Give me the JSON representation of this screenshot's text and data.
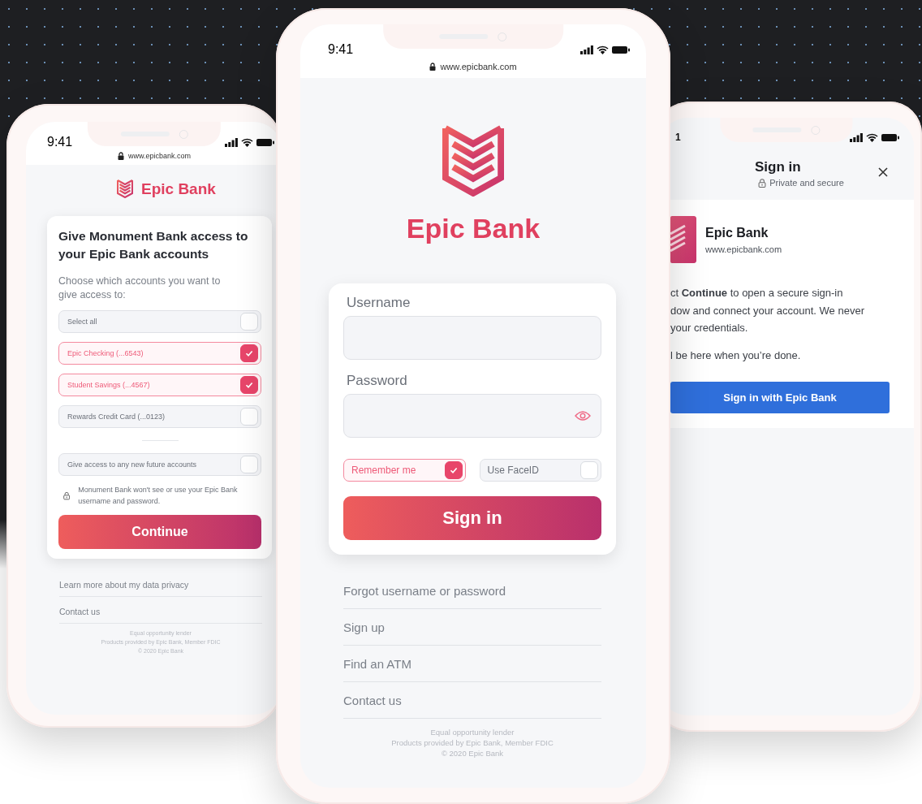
{
  "left_phone": {
    "status_time": "9:41",
    "url": "www.epicbank.com",
    "brand": "Epic Bank",
    "title": "Give Monument Bank access to your Epic Bank accounts",
    "subtitle": "Choose which accounts you want to give access to:",
    "accounts": [
      {
        "label": "Select all",
        "checked": false
      },
      {
        "label": "Epic Checking (...6543)",
        "checked": true
      },
      {
        "label": "Student Savings (...4567)",
        "checked": true
      },
      {
        "label": "Rewards Credit Card (...0123)",
        "checked": false
      }
    ],
    "future_accounts": {
      "label": "Give access to any new future accounts",
      "checked": false
    },
    "privacy_note": "Monument Bank won't see or use your Epic Bank username and password.",
    "continue_button": "Continue",
    "links": [
      "Learn more about my data privacy",
      "Contact us"
    ],
    "footer": [
      "Equal opportunity lender",
      "Products provided by Epic Bank, Member FDIC",
      "© 2020 Epic Bank"
    ]
  },
  "center_phone": {
    "status_time": "9:41",
    "url": "www.epicbank.com",
    "brand": "Epic Bank",
    "username_label": "Username",
    "password_label": "Password",
    "options": [
      {
        "label": "Remember me",
        "checked": true
      },
      {
        "label": "Use FaceID",
        "checked": false
      }
    ],
    "sign_in_button": "Sign in",
    "links": [
      "Forgot username or password",
      "Sign up",
      "Find an ATM",
      "Contact us"
    ],
    "footer": [
      "Equal opportunity lender",
      "Products provided by Epic Bank, Member FDIC",
      "© 2020 Epic Bank"
    ]
  },
  "right_phone": {
    "status_time": "1",
    "title": "Sign in",
    "subtitle": "Private and secure",
    "bank_name": "Epic Bank",
    "bank_url": "www.epicbank.com",
    "body_lines": [
      "ct **Continue** to open a secure sign-in",
      "dow and connect your account. We never",
      "your credentials."
    ],
    "closing_line": "l be here when you’re done.",
    "sign_in_button": "Sign in with Epic Bank"
  }
}
